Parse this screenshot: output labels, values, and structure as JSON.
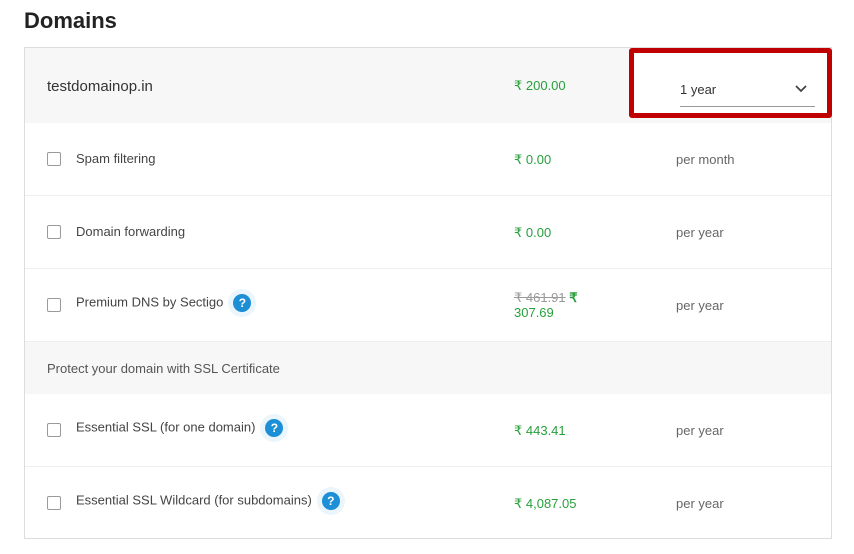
{
  "page": {
    "title": "Domains"
  },
  "domain": {
    "name": "testdomainop.in",
    "price": "₹ 200.00",
    "term_select": {
      "value": "1 year"
    }
  },
  "addons": [
    {
      "label": "Spam filtering",
      "price": "₹ 0.00",
      "period": "per month",
      "help": false
    },
    {
      "label": "Domain forwarding",
      "price": "₹ 0.00",
      "period": "per year",
      "help": false
    },
    {
      "label": "Premium DNS by Sectigo",
      "old_price": "₹ 461.91",
      "price_prefix": " ₹",
      "price": "307.69",
      "period": "per year",
      "help": true
    }
  ],
  "ssl_section": {
    "title": "Protect your domain with SSL Certificate",
    "items": [
      {
        "label": "Essential SSL (for one domain)",
        "price": "₹ 443.41",
        "period": "per year",
        "help": true
      },
      {
        "label": "Essential SSL Wildcard (for subdomains)",
        "price": "₹ 4,087.05",
        "period": "per year",
        "help": true
      }
    ]
  },
  "icons": {
    "help": "?",
    "chevron": "chevron-down-icon"
  },
  "colors": {
    "price_green": "#27a03c",
    "help_blue": "#1d8fd6",
    "highlight_red": "#c00000"
  }
}
